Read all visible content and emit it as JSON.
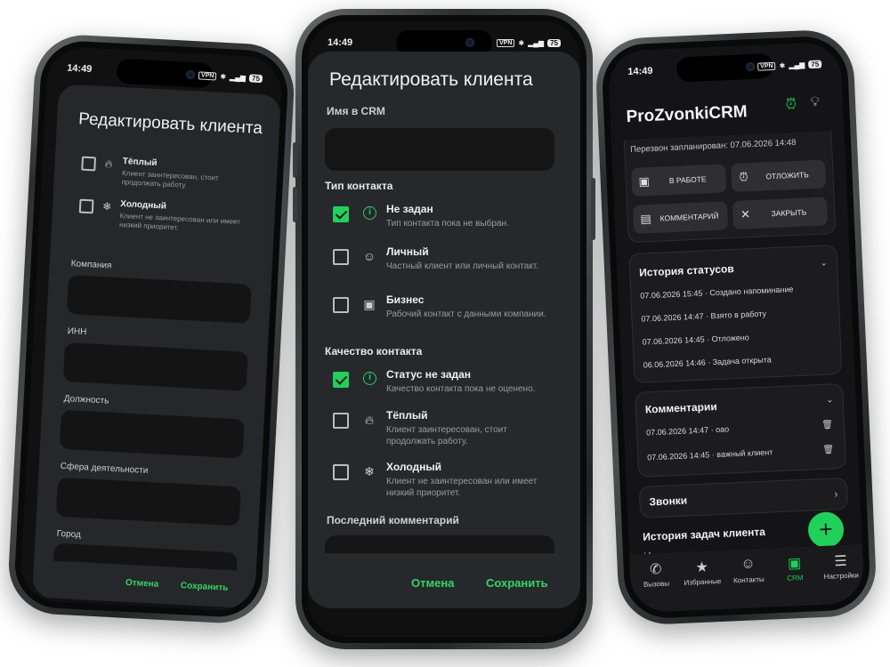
{
  "status_bar": {
    "time": "14:49",
    "vpn": "VPN",
    "battery": "75",
    "network": "Vo LTE"
  },
  "edit_dialog": {
    "title": "Редактировать клиента",
    "crm_name_label": "Имя в CRM",
    "crm_name_value": "",
    "contact_type_label": "Тип контакта",
    "contact_types": [
      {
        "title": "Не задан",
        "desc": "Тип контакта пока не выбран.",
        "checked": true,
        "icon": "info-icon"
      },
      {
        "title": "Личный",
        "desc": "Частный клиент или личный контакт.",
        "checked": false,
        "icon": "person-icon"
      },
      {
        "title": "Бизнес",
        "desc": "Рабочий контакт с данными компании.",
        "checked": false,
        "icon": "briefcase-icon"
      }
    ],
    "quality_label": "Качество контакта",
    "qualities": [
      {
        "title": "Статус не задан",
        "desc": "Качество контакта пока не оценено.",
        "checked": true,
        "icon": "info-icon"
      },
      {
        "title": "Тёплый",
        "desc": "Клиент заинтересован, стоит продолжать работу.",
        "checked": false,
        "icon": "flame-icon"
      },
      {
        "title": "Холодный",
        "desc": "Клиент не заинтересован или имеет низкий приоритет.",
        "checked": false,
        "icon": "snowflake-icon"
      }
    ],
    "last_comment_label": "Последний комментарий",
    "cancel": "Отмена",
    "save": "Сохранить"
  },
  "left_dialog": {
    "title": "Редактировать клиента",
    "options": [
      {
        "title": "Тёплый",
        "desc": "Клиент заинтересован, стоит продолжать работу.",
        "icon": "flame-icon"
      },
      {
        "title": "Холодный",
        "desc": "Клиент не заинтересован или имеет низкий приоритет.",
        "icon": "snowflake-icon"
      }
    ],
    "fields": [
      "Компания",
      "ИНН",
      "Должность",
      "Сфера деятельности",
      "Город"
    ],
    "cancel": "Отмена",
    "save": "Сохранить"
  },
  "crm": {
    "app_title": "ProZvonkiCRM",
    "scheduled": "Перезвон запланирован: 07.06.2026 14:48",
    "actions": {
      "in_work": "В РАБОТЕ",
      "postpone": "ОТЛОЖИТЬ",
      "comment": "КОММЕНТАРИЙ",
      "close": "ЗАКРЫТЬ"
    },
    "history_title": "История статусов",
    "history": [
      "07.06.2026 15:45 · Создано напоминание",
      "07.06.2026 14:47 · Взято в работу",
      "07.06.2026 14:45 · Отложено",
      "06.06.2026 14:46 · Задача открыта"
    ],
    "comments_title": "Комментарии",
    "comments": [
      "07.06.2026 14:47 · оао",
      "07.06.2026 14:45 · важный клиент"
    ],
    "calls_title": "Звонки",
    "tasks_title": "История задач клиента",
    "tasks_empty": "Истории пока нет.",
    "nav": [
      "Вызовы",
      "Избранные",
      "Контакты",
      "CRM",
      "Настройки"
    ],
    "accent": "#1fd15a"
  }
}
